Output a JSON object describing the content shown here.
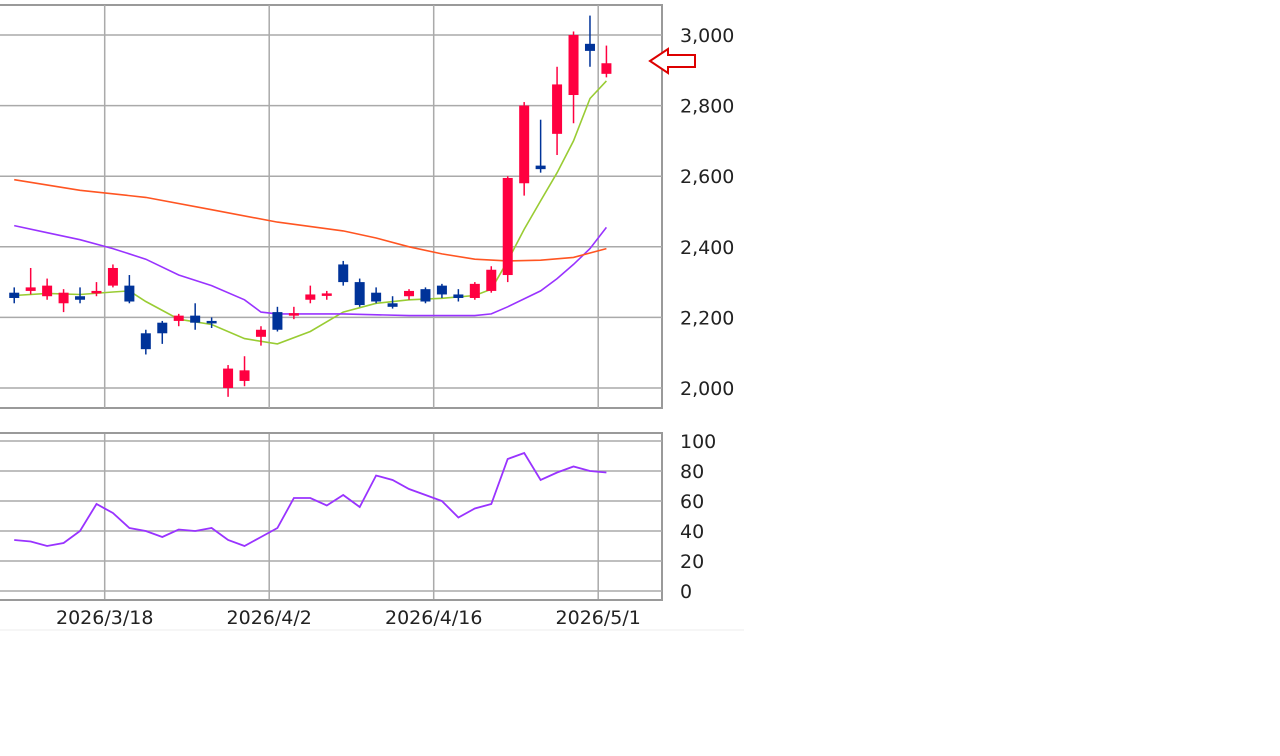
{
  "chart_data": [
    {
      "panel": "price",
      "type": "candlestick",
      "title": "",
      "xlabel": "",
      "ylabel": "",
      "ylim": [
        1950,
        3100
      ],
      "yticks": [
        2000,
        2200,
        2400,
        2600,
        2800,
        3000
      ],
      "ytick_labels": [
        "2,000",
        "2,200",
        "2,400",
        "2,600",
        "2,800",
        "3,000"
      ],
      "grid": true,
      "up_color": "#ff0040",
      "down_color": "#003399",
      "current_price_marker": {
        "price": 2915,
        "color": "#dd0000",
        "shape": "left-arrow"
      },
      "candles": [
        {
          "x": 0,
          "o": 2270,
          "h": 2285,
          "l": 2240,
          "c": 2255
        },
        {
          "x": 1,
          "o": 2275,
          "h": 2340,
          "l": 2265,
          "c": 2285
        },
        {
          "x": 2,
          "o": 2260,
          "h": 2310,
          "l": 2250,
          "c": 2290
        },
        {
          "x": 3,
          "o": 2240,
          "h": 2280,
          "l": 2215,
          "c": 2270
        },
        {
          "x": 4,
          "o": 2260,
          "h": 2285,
          "l": 2240,
          "c": 2250
        },
        {
          "x": 5,
          "o": 2270,
          "h": 2300,
          "l": 2260,
          "c": 2275
        },
        {
          "x": 6,
          "o": 2290,
          "h": 2350,
          "l": 2285,
          "c": 2340
        },
        {
          "x": 7,
          "o": 2290,
          "h": 2320,
          "l": 2240,
          "c": 2245
        },
        {
          "x": 8,
          "o": 2155,
          "h": 2165,
          "l": 2095,
          "c": 2110
        },
        {
          "x": 9,
          "o": 2185,
          "h": 2190,
          "l": 2125,
          "c": 2155
        },
        {
          "x": 10,
          "o": 2190,
          "h": 2210,
          "l": 2175,
          "c": 2205
        },
        {
          "x": 11,
          "o": 2205,
          "h": 2240,
          "l": 2165,
          "c": 2185
        },
        {
          "x": 12,
          "o": 2190,
          "h": 2200,
          "l": 2170,
          "c": 2185
        },
        {
          "x": 13,
          "o": 2000,
          "h": 2065,
          "l": 1975,
          "c": 2055
        },
        {
          "x": 14,
          "o": 2020,
          "h": 2090,
          "l": 2005,
          "c": 2050
        },
        {
          "x": 15,
          "o": 2145,
          "h": 2175,
          "l": 2120,
          "c": 2165
        },
        {
          "x": 16,
          "o": 2215,
          "h": 2230,
          "l": 2160,
          "c": 2165
        },
        {
          "x": 17,
          "o": 2210,
          "h": 2230,
          "l": 2195,
          "c": 2212
        },
        {
          "x": 18,
          "o": 2250,
          "h": 2290,
          "l": 2240,
          "c": 2265
        },
        {
          "x": 19,
          "o": 2265,
          "h": 2275,
          "l": 2250,
          "c": 2268
        },
        {
          "x": 20,
          "o": 2350,
          "h": 2360,
          "l": 2290,
          "c": 2300
        },
        {
          "x": 21,
          "o": 2300,
          "h": 2310,
          "l": 2230,
          "c": 2235
        },
        {
          "x": 22,
          "o": 2270,
          "h": 2285,
          "l": 2240,
          "c": 2245
        },
        {
          "x": 23,
          "o": 2240,
          "h": 2260,
          "l": 2225,
          "c": 2230
        },
        {
          "x": 24,
          "o": 2260,
          "h": 2280,
          "l": 2250,
          "c": 2275
        },
        {
          "x": 25,
          "o": 2280,
          "h": 2285,
          "l": 2240,
          "c": 2245
        },
        {
          "x": 26,
          "o": 2290,
          "h": 2295,
          "l": 2255,
          "c": 2265
        },
        {
          "x": 27,
          "o": 2265,
          "h": 2280,
          "l": 2245,
          "c": 2255
        },
        {
          "x": 28,
          "o": 2255,
          "h": 2300,
          "l": 2250,
          "c": 2295
        },
        {
          "x": 29,
          "o": 2275,
          "h": 2345,
          "l": 2270,
          "c": 2335
        },
        {
          "x": 30,
          "o": 2320,
          "h": 2600,
          "l": 2300,
          "c": 2595
        },
        {
          "x": 31,
          "o": 2580,
          "h": 2810,
          "l": 2545,
          "c": 2800
        },
        {
          "x": 32,
          "o": 2630,
          "h": 2760,
          "l": 2610,
          "c": 2620
        },
        {
          "x": 33,
          "o": 2720,
          "h": 2910,
          "l": 2660,
          "c": 2860
        },
        {
          "x": 34,
          "o": 2830,
          "h": 3010,
          "l": 2750,
          "c": 3000
        },
        {
          "x": 35,
          "o": 2975,
          "h": 3055,
          "l": 2910,
          "c": 2955
        },
        {
          "x": 36,
          "o": 2890,
          "h": 2970,
          "l": 2880,
          "c": 2920
        }
      ],
      "moving_averages": [
        {
          "color": "#99cc33",
          "points": [
            [
              0,
              2262
            ],
            [
              2,
              2268
            ],
            [
              4,
              2265
            ],
            [
              6,
              2272
            ],
            [
              7,
              2275
            ],
            [
              8,
              2245
            ],
            [
              10,
              2195
            ],
            [
              12,
              2180
            ],
            [
              14,
              2140
            ],
            [
              16,
              2125
            ],
            [
              18,
              2160
            ],
            [
              20,
              2215
            ],
            [
              22,
              2240
            ],
            [
              24,
              2250
            ],
            [
              26,
              2254
            ],
            [
              28,
              2262
            ],
            [
              29,
              2280
            ],
            [
              30,
              2360
            ],
            [
              31,
              2450
            ],
            [
              32,
              2530
            ],
            [
              33,
              2610
            ],
            [
              34,
              2700
            ],
            [
              35,
              2820
            ],
            [
              36,
              2870
            ]
          ]
        },
        {
          "color": "#9933ff",
          "points": [
            [
              0,
              2460
            ],
            [
              2,
              2440
            ],
            [
              4,
              2420
            ],
            [
              6,
              2395
            ],
            [
              8,
              2365
            ],
            [
              10,
              2320
            ],
            [
              12,
              2290
            ],
            [
              14,
              2250
            ],
            [
              15,
              2215
            ],
            [
              16,
              2210
            ],
            [
              20,
              2210
            ],
            [
              24,
              2205
            ],
            [
              28,
              2205
            ],
            [
              29,
              2210
            ],
            [
              30,
              2230
            ],
            [
              32,
              2275
            ],
            [
              33,
              2310
            ],
            [
              34,
              2350
            ],
            [
              35,
              2395
            ],
            [
              36,
              2455
            ]
          ]
        },
        {
          "color": "#ff5522",
          "points": [
            [
              0,
              2590
            ],
            [
              4,
              2560
            ],
            [
              8,
              2540
            ],
            [
              12,
              2505
            ],
            [
              16,
              2470
            ],
            [
              20,
              2445
            ],
            [
              22,
              2425
            ],
            [
              24,
              2400
            ],
            [
              26,
              2380
            ],
            [
              28,
              2365
            ],
            [
              30,
              2360
            ],
            [
              32,
              2362
            ],
            [
              34,
              2370
            ],
            [
              36,
              2395
            ]
          ]
        }
      ]
    },
    {
      "panel": "oscillator",
      "type": "line",
      "title": "",
      "xlabel": "",
      "ylabel": "",
      "ylim": [
        0,
        100
      ],
      "yticks": [
        0,
        20,
        40,
        60,
        80,
        100
      ],
      "ytick_labels": [
        "0",
        "20",
        "40",
        "60",
        "80",
        "100"
      ],
      "grid": true,
      "series": [
        {
          "color": "#9933ff",
          "x": [
            0,
            1,
            2,
            3,
            4,
            5,
            6,
            7,
            8,
            9,
            10,
            11,
            12,
            13,
            14,
            15,
            16,
            17,
            18,
            19,
            20,
            21,
            22,
            23,
            24,
            25,
            26,
            27,
            28,
            29,
            30,
            31,
            32,
            33,
            34,
            35,
            36
          ],
          "values": [
            34,
            33,
            30,
            32,
            40,
            58,
            52,
            42,
            40,
            36,
            41,
            40,
            42,
            34,
            30,
            36,
            42,
            62,
            62,
            57,
            64,
            56,
            77,
            74,
            68,
            64,
            60,
            49,
            55,
            58,
            88,
            92,
            74,
            79,
            83,
            80,
            79
          ]
        }
      ],
      "x_tick_labels": [
        {
          "x": 5.5,
          "label": "2026/3/18"
        },
        {
          "x": 15.5,
          "label": "2026/4/2"
        },
        {
          "x": 25.5,
          "label": "2026/4/16"
        },
        {
          "x": 35.5,
          "label": "2026/5/1"
        }
      ]
    }
  ]
}
